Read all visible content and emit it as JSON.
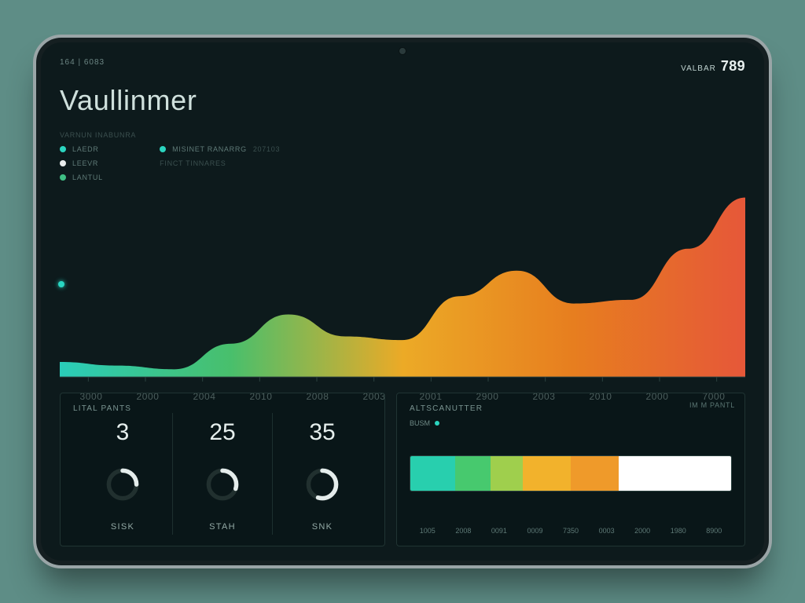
{
  "header": {
    "small_left": "164 | 6083",
    "small_right_label": "VALBAR",
    "small_right_value": "789"
  },
  "title": "Vaullinmer",
  "legend": {
    "heading": "VARNUN INABUNRA",
    "col1": [
      {
        "color": "#2bd4bf",
        "label": "LAEDR"
      },
      {
        "color": "#e9ecec",
        "label": "LEEVR"
      },
      {
        "color": "#3fbf84",
        "label": "LANTUL"
      }
    ],
    "col2": [
      {
        "color": "#2bd4bf",
        "label": "MISINET RANARRG",
        "extra": "207103"
      },
      {
        "label_only": "FINCT TINNARES"
      }
    ]
  },
  "chart_data": {
    "type": "area",
    "x_ticks": [
      "3000",
      "2000",
      "2004",
      "2010",
      "2008",
      "2003",
      "2001",
      "2900",
      "2003",
      "2010",
      "2000",
      "7000"
    ],
    "ylim": [
      0,
      100
    ],
    "series": [
      {
        "name": "primary",
        "gradient": [
          "#2bd4bf",
          "#4bc66f",
          "#f5b027",
          "#f0821f",
          "#ef5a3a"
        ],
        "values": [
          8,
          6,
          4,
          18,
          34,
          22,
          20,
          44,
          58,
          40,
          42,
          70,
          98
        ]
      }
    ]
  },
  "stats": {
    "title": "LITAL PANTS",
    "items": [
      {
        "value": "3",
        "ring_pct": 25,
        "ring_color": "#e4eceb",
        "label": "Sisk"
      },
      {
        "value": "25",
        "ring_pct": 30,
        "ring_color": "#e4eceb",
        "label": "Stah"
      },
      {
        "value": "35",
        "ring_pct": 55,
        "ring_color": "#e4eceb",
        "label": "SNK"
      }
    ]
  },
  "seg": {
    "title": "Altscanutter",
    "mini_label": "BUSM",
    "corner": "IM M PANTL",
    "ticks": [
      "1005",
      "2008",
      "0091",
      "0009",
      "7350",
      "0003",
      "2000",
      "1980",
      "8900"
    ],
    "segments": [
      {
        "color": "#28cfae",
        "w": 14
      },
      {
        "color": "#47c96e",
        "w": 11
      },
      {
        "color": "#9fcf4d",
        "w": 10
      },
      {
        "color": "#f2b22c",
        "w": 15
      },
      {
        "color": "#ef9a2a",
        "w": 15
      },
      {
        "color": "#ffffff",
        "w": 35
      }
    ]
  }
}
